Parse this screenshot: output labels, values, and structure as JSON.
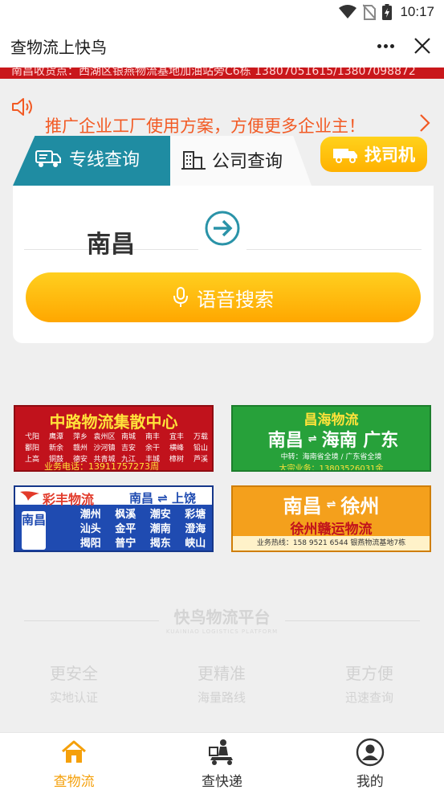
{
  "status_bar": {
    "time": "10:17",
    "icons": [
      "wifi-icon",
      "no-sim-icon",
      "battery-icon"
    ]
  },
  "title_bar": {
    "title": "查物流上快鸟",
    "more_icon": "more-dots-icon",
    "close_icon": "close-icon"
  },
  "marquee": {
    "text": "南昌收货点：西湖区银燕物流基地加油站旁C6栋  13807051615/13807098872"
  },
  "notice": {
    "icon": "speaker-icon",
    "text": "推广企业工厂使用方案，方便更多企业主！",
    "arrow_icon": "chevron-right-icon"
  },
  "tabs": {
    "active": {
      "label": "专线查询",
      "icon": "truck-icon"
    },
    "inactive": {
      "label": "公司查询",
      "icon": "building-icon"
    },
    "driver_button": {
      "label": "找司机",
      "icon": "van-icon"
    }
  },
  "search": {
    "from": "南昌",
    "to": "",
    "swap_icon": "arrow-right-circle-icon",
    "voice_button": {
      "label": "语音搜索",
      "icon": "microphone-icon"
    }
  },
  "ads": {
    "ad1": {
      "title": "中路物流集散中心",
      "cities": [
        "弋阳",
        "鹰潭",
        "萍乡",
        "袁州区",
        "南城",
        "南丰",
        "宜丰",
        "万载",
        "鄱阳",
        "新余",
        "赣州",
        "沙河镇",
        "吉安",
        "余干",
        "横峰",
        "铅山",
        "上高",
        "铜鼓",
        "德安",
        "共青城",
        "九江",
        "丰城",
        "樟树",
        "芦溪"
      ],
      "phone": "业务电话：13911757273周"
    },
    "ad2": {
      "top": "昌海物流",
      "from": "南昌",
      "to": "海南 广东",
      "arrow": "⇌",
      "sub1": "中转：海南省全境 / 广东省全境",
      "sub2": "大宗业务：13803526031余"
    },
    "ad3": {
      "brand": "彩丰物流",
      "route": "南昌 ⇌ 上饶",
      "origin": "南昌",
      "cities": [
        "潮州",
        "枫溪",
        "潮安",
        "彩塘",
        "汕头",
        "金平",
        "潮南",
        "澄海",
        "揭阳",
        "普宁",
        "揭东",
        "峡山"
      ]
    },
    "ad4": {
      "from": "南昌",
      "to": "徐州",
      "arrow": "⇌",
      "brand": "徐州赣运物流",
      "footer": "业务热线：158 9521 6544  银燕物流基地7栋"
    }
  },
  "platform": {
    "title": "快鸟物流平台",
    "subtitle": "KUAINIAO LOGISTICS PLATFORM"
  },
  "features": [
    {
      "title": "更安全",
      "sub": "实地认证"
    },
    {
      "title": "更精准",
      "sub": "海量路线"
    },
    {
      "title": "更方便",
      "sub": "迅速查询"
    }
  ],
  "bottom_nav": [
    {
      "label": "查物流",
      "icon": "home-icon",
      "active": true
    },
    {
      "label": "查快递",
      "icon": "courier-icon",
      "active": false
    },
    {
      "label": "我的",
      "icon": "user-icon",
      "active": false
    }
  ],
  "colors": {
    "accent_orange": "#ffb100",
    "tab_teal": "#1f8ca2",
    "notice_orange": "#f25a24",
    "marquee_red": "#c9171b"
  }
}
